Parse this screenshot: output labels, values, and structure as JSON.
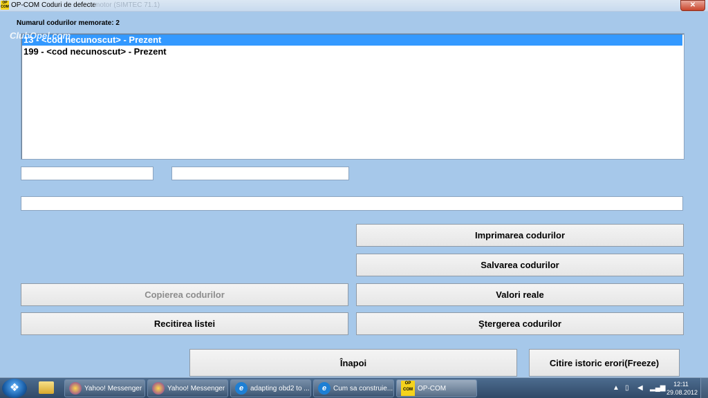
{
  "window": {
    "app_name": "OP-COM",
    "title": "Coduri de defecte",
    "title_dim": "motor (SIMTEC 71.1)",
    "close_glyph": "✕",
    "logo_text_top": "OP",
    "logo_text_bottom": "COM"
  },
  "watermark": "ClubOpel.com",
  "count_label": "Numarul codurilor memorate: 2",
  "codes": [
    {
      "text": "13 - <cod necunoscut> - Prezent",
      "selected": true
    },
    {
      "text": "199 - <cod necunoscut> - Prezent",
      "selected": false
    }
  ],
  "fields": {
    "field_a": "",
    "field_b": "",
    "field_c": ""
  },
  "buttons": {
    "print": "Imprimarea codurilor",
    "save": "Salvarea codurilor",
    "copy": "Copierea codurilor",
    "live": "Valori reale",
    "reread": "Recitirea listei",
    "erase": "Ştergerea codurilor",
    "back": "Înapoi",
    "freeze": "Citire istoric erori(Freeze)"
  },
  "taskbar": {
    "start_glyph": "❖",
    "tasks": [
      {
        "label": "Yahoo! Messenger",
        "icon": "yahoo-messenger-icon"
      },
      {
        "label": "Yahoo! Messenger",
        "icon": "yahoo-messenger-icon"
      },
      {
        "label": "adapting obd2 to ...",
        "icon": "internet-explorer-icon"
      },
      {
        "label": "Cum sa construie...",
        "icon": "internet-explorer-icon"
      },
      {
        "label": "OP-COM",
        "icon": "opcom-icon"
      }
    ],
    "clock_time": "12:11",
    "clock_date": "29.08.2012"
  },
  "colors": {
    "background": "#a6c8ea",
    "selection": "#3399ff"
  }
}
